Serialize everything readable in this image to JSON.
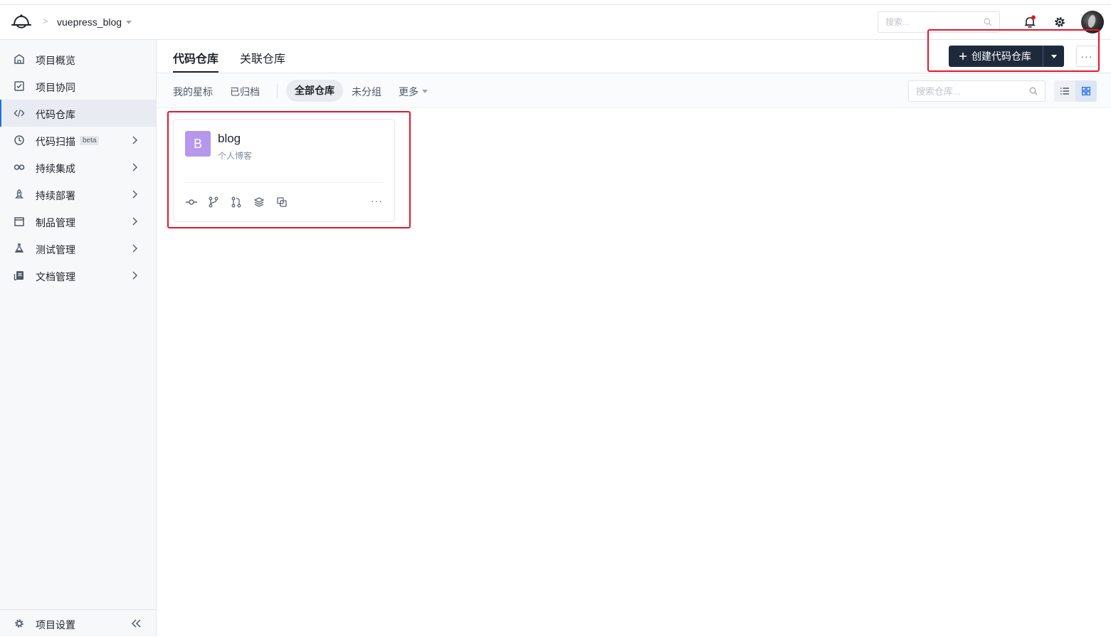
{
  "header": {
    "project_name": "vuepress_blog",
    "breadcrumb_separator": ">",
    "search_placeholder": "搜索..."
  },
  "sidebar": {
    "items": [
      {
        "label": "项目概览",
        "icon": "home-icon"
      },
      {
        "label": "项目协同",
        "icon": "checkbox-icon"
      },
      {
        "label": "代码仓库",
        "icon": "code-icon",
        "active": true
      },
      {
        "label": "代码扫描",
        "icon": "scan-icon",
        "badge": "beta"
      },
      {
        "label": "持续集成",
        "icon": "infinity-icon"
      },
      {
        "label": "持续部署",
        "icon": "rocket-icon"
      },
      {
        "label": "制品管理",
        "icon": "package-icon"
      },
      {
        "label": "测试管理",
        "icon": "flask-icon"
      },
      {
        "label": "文档管理",
        "icon": "document-icon"
      }
    ],
    "settings_label": "项目设置"
  },
  "tabs": {
    "repos": "代码仓库",
    "linked": "关联仓库"
  },
  "toolbar": {
    "create_label": "创建代码仓库",
    "more_label": "···"
  },
  "filters": {
    "starred": "我的星标",
    "archived": "已归档",
    "all": "全部仓库",
    "ungrouped": "未分组",
    "more": "更多",
    "search_placeholder": "搜索仓库..."
  },
  "repo_card": {
    "initial": "B",
    "name": "blog",
    "description": "个人博客",
    "more_label": "···"
  },
  "colors": {
    "accent": "#1f6fe5",
    "primary_button": "#1e2a3b",
    "highlight": "#e8152c",
    "avatar_purple": "#b597ec"
  }
}
